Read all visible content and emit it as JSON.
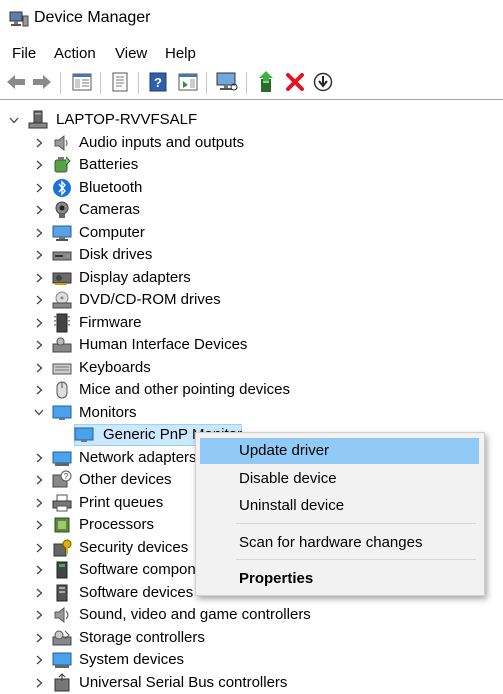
{
  "window": {
    "title": "Device Manager"
  },
  "menu": [
    "File",
    "Action",
    "View",
    "Help"
  ],
  "toolbar": {
    "icons": [
      "back-icon",
      "forward-icon",
      "show-hide-tree-icon",
      "properties-icon",
      "help-icon",
      "action-pane-icon",
      "monitor-scan-icon",
      "update-driver-icon",
      "uninstall-icon",
      "download-icon"
    ]
  },
  "tree": {
    "root": "LAPTOP-RVVFSALF",
    "categories": [
      {
        "label": "Audio inputs and outputs",
        "icon": "speaker-icon"
      },
      {
        "label": "Batteries",
        "icon": "battery-icon"
      },
      {
        "label": "Bluetooth",
        "icon": "bluetooth-icon"
      },
      {
        "label": "Cameras",
        "icon": "camera-icon"
      },
      {
        "label": "Computer",
        "icon": "computer-icon"
      },
      {
        "label": "Disk drives",
        "icon": "disk-drive-icon"
      },
      {
        "label": "Display adapters",
        "icon": "display-adapter-icon"
      },
      {
        "label": "DVD/CD-ROM drives",
        "icon": "dvd-drive-icon"
      },
      {
        "label": "Firmware",
        "icon": "firmware-icon"
      },
      {
        "label": "Human Interface Devices",
        "icon": "hid-icon"
      },
      {
        "label": "Keyboards",
        "icon": "keyboard-icon"
      },
      {
        "label": "Mice and other pointing devices",
        "icon": "mouse-icon"
      },
      {
        "label": "Monitors",
        "icon": "monitor-icon",
        "expanded": true
      },
      {
        "label": "Generic PnP Monitor",
        "icon": "monitor-icon",
        "child": true,
        "selected": true
      },
      {
        "label": "Network adapters",
        "icon": "network-adapter-icon"
      },
      {
        "label": "Other devices",
        "icon": "unknown-device-icon"
      },
      {
        "label": "Print queues",
        "icon": "printer-icon"
      },
      {
        "label": "Processors",
        "icon": "processor-icon"
      },
      {
        "label": "Security devices",
        "icon": "security-device-icon"
      },
      {
        "label": "Software components",
        "icon": "software-component-icon"
      },
      {
        "label": "Software devices",
        "icon": "software-device-icon"
      },
      {
        "label": "Sound, video and game controllers",
        "icon": "sound-controller-icon"
      },
      {
        "label": "Storage controllers",
        "icon": "storage-controller-icon"
      },
      {
        "label": "System devices",
        "icon": "system-device-icon"
      },
      {
        "label": "Universal Serial Bus controllers",
        "icon": "usb-icon"
      }
    ]
  },
  "context_menu": {
    "items": [
      {
        "label": "Update driver",
        "highlighted": true
      },
      {
        "label": "Disable device"
      },
      {
        "label": "Uninstall device"
      },
      {
        "label": "Scan for hardware changes"
      },
      {
        "label": "Properties",
        "bold": true
      }
    ]
  },
  "colors": {
    "selection": "#cce8ff",
    "menu_highlight": "#91c9f7",
    "delete_red": "#e81123"
  }
}
